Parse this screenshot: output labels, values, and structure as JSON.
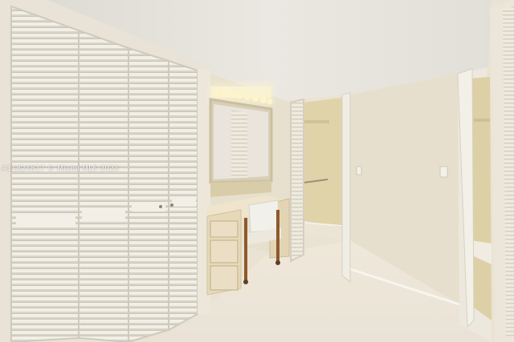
{
  "watermark": {
    "text": "A11824817 © Miami MLS 2024"
  },
  "colors": {
    "ceiling": "#e9e6e0",
    "wall": "#e7e0cf",
    "closet_wall": "#e2d6b2",
    "floor": "#ece6dc",
    "door_white": "#f1efe6",
    "vanity": "#e8dcc0",
    "chair_wood": "#8c5a2e",
    "light_bulb": "#fff3c2"
  }
}
